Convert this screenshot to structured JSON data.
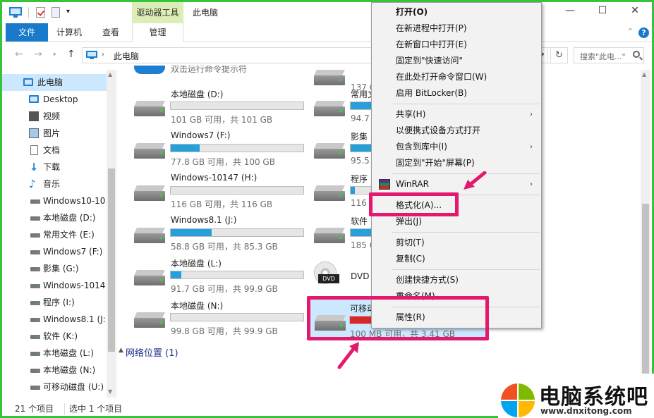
{
  "titlebar": {
    "context_tab": "驱动器工具",
    "title": "此电脑",
    "minimize": "—",
    "maximize": "☐",
    "close": "✕"
  },
  "ribbon": {
    "tabs": [
      "文件",
      "计算机",
      "查看",
      "管理"
    ]
  },
  "address": {
    "path": "此电脑",
    "search_placeholder": "搜索\"此电...\""
  },
  "nav": {
    "items": [
      {
        "label": "此电脑",
        "icon": "monitor-icon"
      },
      {
        "label": "Desktop",
        "icon": "desktop-icon"
      },
      {
        "label": "视频",
        "icon": "video-icon"
      },
      {
        "label": "图片",
        "icon": "picture-icon"
      },
      {
        "label": "文档",
        "icon": "document-icon"
      },
      {
        "label": "下载",
        "icon": "download-icon"
      },
      {
        "label": "音乐",
        "icon": "music-icon"
      },
      {
        "label": "Windows10-10",
        "icon": "drive-icon"
      },
      {
        "label": "本地磁盘 (D:)",
        "icon": "drive-icon"
      },
      {
        "label": "常用文件 (E:)",
        "icon": "drive-icon"
      },
      {
        "label": "Windows7 (F:)",
        "icon": "drive-icon"
      },
      {
        "label": "影集 (G:)",
        "icon": "drive-icon"
      },
      {
        "label": "Windows-1014",
        "icon": "drive-icon"
      },
      {
        "label": "程序 (I:)",
        "icon": "drive-icon"
      },
      {
        "label": "Windows8.1 (J:",
        "icon": "drive-icon"
      },
      {
        "label": "软件 (K:)",
        "icon": "drive-icon"
      },
      {
        "label": "本地磁盘 (L:)",
        "icon": "drive-icon"
      },
      {
        "label": "本地磁盘 (N:)",
        "icon": "drive-icon"
      },
      {
        "label": "可移动磁盘 (U:)",
        "icon": "drive-icon"
      }
    ]
  },
  "content": {
    "partial_top_text": "双击运行命令提示符",
    "drives_left": [
      {
        "name": "本地磁盘 (D:)",
        "info": "101 GB 可用，共 101 GB",
        "used": 0.0
      },
      {
        "name": "Windows7 (F:)",
        "info": "77.8 GB 可用，共 100 GB",
        "used": 0.22
      },
      {
        "name": "Windows-10147 (H:)",
        "info": "116 GB 可用，共 116 GB",
        "used": 0.0
      },
      {
        "name": "Windows8.1 (J:)",
        "info": "58.8 GB 可用，共 85.3 GB",
        "used": 0.31
      },
      {
        "name": "本地磁盘 (L:)",
        "info": "91.7 GB 可用，共 99.9 GB",
        "used": 0.08
      },
      {
        "name": "本地磁盘 (N:)",
        "info": "99.8 GB 可用，共 99.9 GB",
        "used": 0.0
      }
    ],
    "drives_right": [
      {
        "name": "",
        "info": "137 G",
        "used": 0.0
      },
      {
        "name": "常用文",
        "info": "94.7 G",
        "used": 0.3
      },
      {
        "name": "影集",
        "info": "95.5 G",
        "used": 0.2
      },
      {
        "name": "程序",
        "info": "116 G",
        "used": 0.03
      },
      {
        "name": "软件",
        "info": "185 G",
        "used": 0.5
      },
      {
        "name": "DVD",
        "info": "",
        "used": 0.0
      }
    ],
    "selected_drive": {
      "name": "可移动",
      "info": "100 MB 可用，共 3.41 GB",
      "used": 0.97
    },
    "dvd_label": "DVD",
    "group_network": "网络位置 (1)"
  },
  "status": {
    "count": "21 个项目",
    "selected": "选中 1 个项目"
  },
  "context_menu": {
    "items": [
      {
        "label": "打开(O)",
        "bold": true
      },
      {
        "label": "在新进程中打开(P)"
      },
      {
        "label": "在新窗口中打开(E)"
      },
      {
        "label": "固定到\"快速访问\""
      },
      {
        "label": "在此处打开命令窗口(W)"
      },
      {
        "label": "启用 BitLocker(B)"
      },
      {
        "label": "共享(H)",
        "submenu": true
      },
      {
        "label": "以便携式设备方式打开"
      },
      {
        "label": "包含到库中(I)",
        "submenu": true
      },
      {
        "label": "固定到\"开始\"屏幕(P)"
      },
      {
        "label": "WinRAR",
        "submenu": true
      },
      {
        "label": "格式化(A)..."
      },
      {
        "label": "弹出(J)"
      },
      {
        "label": "剪切(T)"
      },
      {
        "label": "复制(C)"
      },
      {
        "label": "创建快捷方式(S)"
      },
      {
        "label": "重命名(M)"
      },
      {
        "label": "属性(R)"
      }
    ]
  },
  "watermark": {
    "title": "电脑系统吧",
    "url": "www.dnxitong.com"
  },
  "colors": {
    "accent": "#1979ca",
    "highlight": "#e4196e",
    "frame": "#36c43a"
  }
}
